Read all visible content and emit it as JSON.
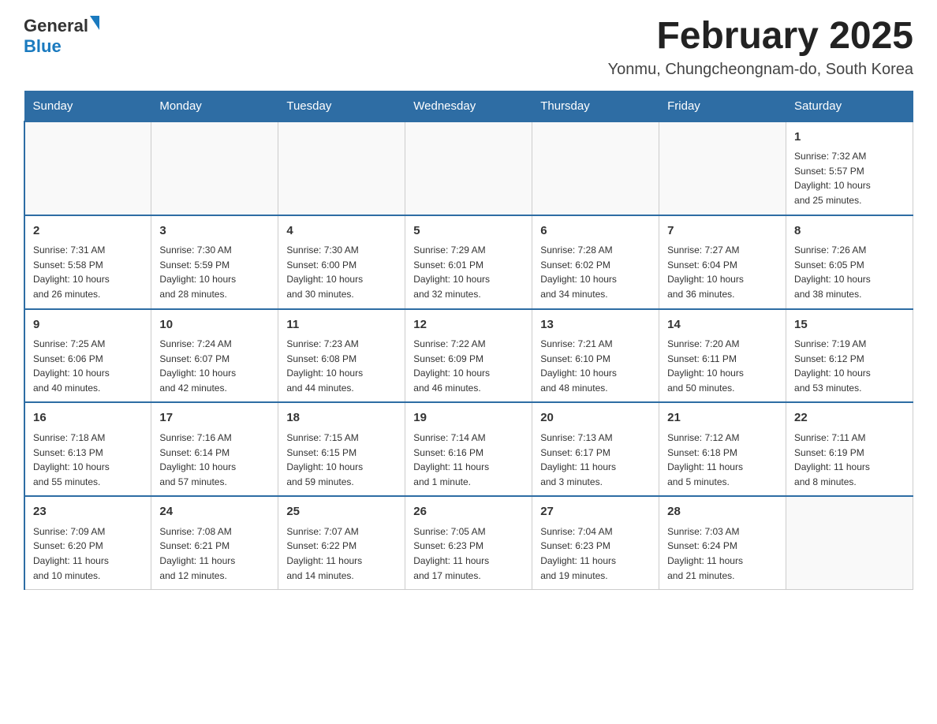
{
  "header": {
    "logo_general": "General",
    "logo_blue": "Blue",
    "main_title": "February 2025",
    "subtitle": "Yonmu, Chungcheongnam-do, South Korea"
  },
  "days_of_week": [
    "Sunday",
    "Monday",
    "Tuesday",
    "Wednesday",
    "Thursday",
    "Friday",
    "Saturday"
  ],
  "weeks": [
    [
      {
        "day": "",
        "info": ""
      },
      {
        "day": "",
        "info": ""
      },
      {
        "day": "",
        "info": ""
      },
      {
        "day": "",
        "info": ""
      },
      {
        "day": "",
        "info": ""
      },
      {
        "day": "",
        "info": ""
      },
      {
        "day": "1",
        "info": "Sunrise: 7:32 AM\nSunset: 5:57 PM\nDaylight: 10 hours\nand 25 minutes."
      }
    ],
    [
      {
        "day": "2",
        "info": "Sunrise: 7:31 AM\nSunset: 5:58 PM\nDaylight: 10 hours\nand 26 minutes."
      },
      {
        "day": "3",
        "info": "Sunrise: 7:30 AM\nSunset: 5:59 PM\nDaylight: 10 hours\nand 28 minutes."
      },
      {
        "day": "4",
        "info": "Sunrise: 7:30 AM\nSunset: 6:00 PM\nDaylight: 10 hours\nand 30 minutes."
      },
      {
        "day": "5",
        "info": "Sunrise: 7:29 AM\nSunset: 6:01 PM\nDaylight: 10 hours\nand 32 minutes."
      },
      {
        "day": "6",
        "info": "Sunrise: 7:28 AM\nSunset: 6:02 PM\nDaylight: 10 hours\nand 34 minutes."
      },
      {
        "day": "7",
        "info": "Sunrise: 7:27 AM\nSunset: 6:04 PM\nDaylight: 10 hours\nand 36 minutes."
      },
      {
        "day": "8",
        "info": "Sunrise: 7:26 AM\nSunset: 6:05 PM\nDaylight: 10 hours\nand 38 minutes."
      }
    ],
    [
      {
        "day": "9",
        "info": "Sunrise: 7:25 AM\nSunset: 6:06 PM\nDaylight: 10 hours\nand 40 minutes."
      },
      {
        "day": "10",
        "info": "Sunrise: 7:24 AM\nSunset: 6:07 PM\nDaylight: 10 hours\nand 42 minutes."
      },
      {
        "day": "11",
        "info": "Sunrise: 7:23 AM\nSunset: 6:08 PM\nDaylight: 10 hours\nand 44 minutes."
      },
      {
        "day": "12",
        "info": "Sunrise: 7:22 AM\nSunset: 6:09 PM\nDaylight: 10 hours\nand 46 minutes."
      },
      {
        "day": "13",
        "info": "Sunrise: 7:21 AM\nSunset: 6:10 PM\nDaylight: 10 hours\nand 48 minutes."
      },
      {
        "day": "14",
        "info": "Sunrise: 7:20 AM\nSunset: 6:11 PM\nDaylight: 10 hours\nand 50 minutes."
      },
      {
        "day": "15",
        "info": "Sunrise: 7:19 AM\nSunset: 6:12 PM\nDaylight: 10 hours\nand 53 minutes."
      }
    ],
    [
      {
        "day": "16",
        "info": "Sunrise: 7:18 AM\nSunset: 6:13 PM\nDaylight: 10 hours\nand 55 minutes."
      },
      {
        "day": "17",
        "info": "Sunrise: 7:16 AM\nSunset: 6:14 PM\nDaylight: 10 hours\nand 57 minutes."
      },
      {
        "day": "18",
        "info": "Sunrise: 7:15 AM\nSunset: 6:15 PM\nDaylight: 10 hours\nand 59 minutes."
      },
      {
        "day": "19",
        "info": "Sunrise: 7:14 AM\nSunset: 6:16 PM\nDaylight: 11 hours\nand 1 minute."
      },
      {
        "day": "20",
        "info": "Sunrise: 7:13 AM\nSunset: 6:17 PM\nDaylight: 11 hours\nand 3 minutes."
      },
      {
        "day": "21",
        "info": "Sunrise: 7:12 AM\nSunset: 6:18 PM\nDaylight: 11 hours\nand 5 minutes."
      },
      {
        "day": "22",
        "info": "Sunrise: 7:11 AM\nSunset: 6:19 PM\nDaylight: 11 hours\nand 8 minutes."
      }
    ],
    [
      {
        "day": "23",
        "info": "Sunrise: 7:09 AM\nSunset: 6:20 PM\nDaylight: 11 hours\nand 10 minutes."
      },
      {
        "day": "24",
        "info": "Sunrise: 7:08 AM\nSunset: 6:21 PM\nDaylight: 11 hours\nand 12 minutes."
      },
      {
        "day": "25",
        "info": "Sunrise: 7:07 AM\nSunset: 6:22 PM\nDaylight: 11 hours\nand 14 minutes."
      },
      {
        "day": "26",
        "info": "Sunrise: 7:05 AM\nSunset: 6:23 PM\nDaylight: 11 hours\nand 17 minutes."
      },
      {
        "day": "27",
        "info": "Sunrise: 7:04 AM\nSunset: 6:23 PM\nDaylight: 11 hours\nand 19 minutes."
      },
      {
        "day": "28",
        "info": "Sunrise: 7:03 AM\nSunset: 6:24 PM\nDaylight: 11 hours\nand 21 minutes."
      },
      {
        "day": "",
        "info": ""
      }
    ]
  ]
}
